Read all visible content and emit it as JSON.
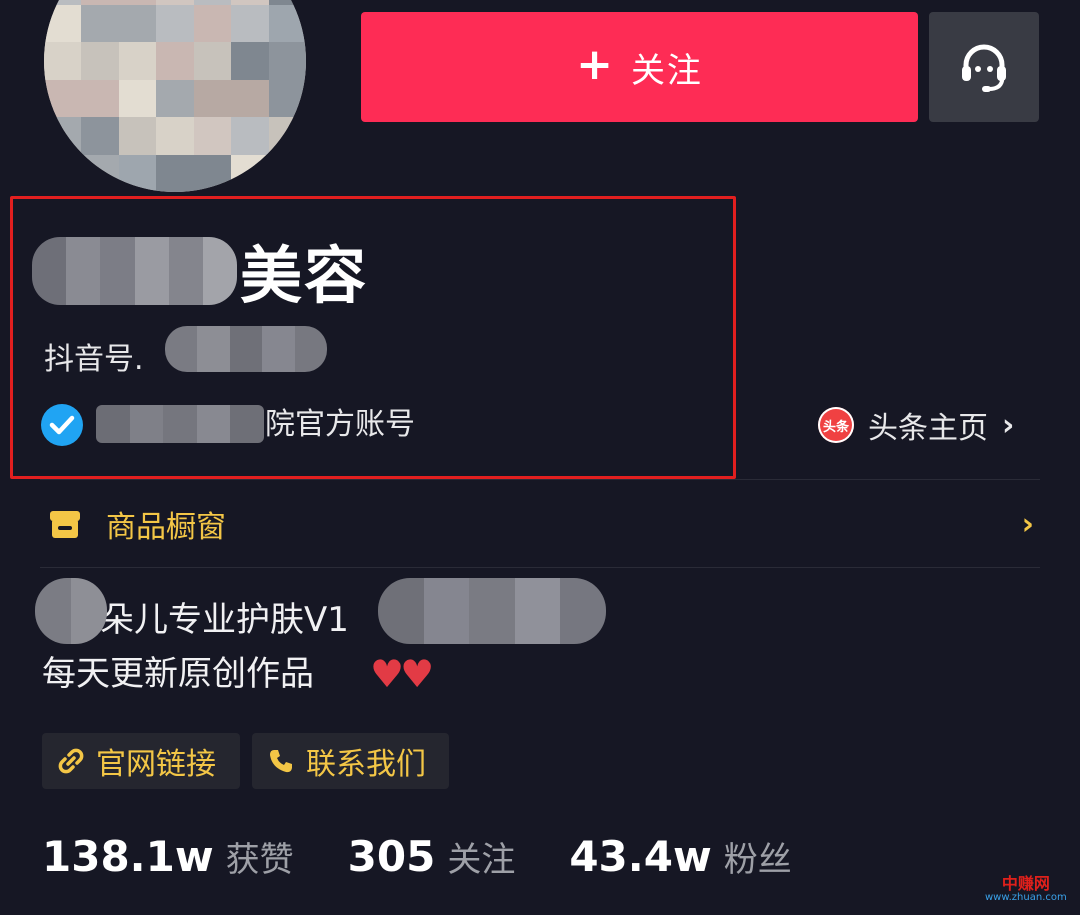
{
  "header": {
    "follow_label": "关注",
    "follow_plus": "+"
  },
  "profile": {
    "nickname_suffix": "美容",
    "douyin_id_label": "抖音号.",
    "verification_text": "院官方账号",
    "toutiao_icon_text": "头条",
    "toutiao_label": "头条主页",
    "chevron": "›"
  },
  "shop": {
    "label": "商品橱窗",
    "chevron": "›"
  },
  "bio": {
    "line1": "朵儿专业护肤V1",
    "line2": "每天更新原创作品",
    "hearts": "♥♥"
  },
  "chips": {
    "site_label": "官网链接",
    "contact_label": "联系我们"
  },
  "stats": [
    {
      "value": "138.1w",
      "label": "获赞"
    },
    {
      "value": "305",
      "label": "关注"
    },
    {
      "value": "43.4w",
      "label": "粉丝"
    }
  ],
  "watermark": {
    "main": "中赚网",
    "sub": "www.zhuan.com"
  },
  "colors": {
    "background": "#161724",
    "follow_button": "#fe2c55",
    "accent_yellow": "#f3c646",
    "highlight_border": "#e21f1f",
    "verify_blue": "#20a4f3"
  }
}
